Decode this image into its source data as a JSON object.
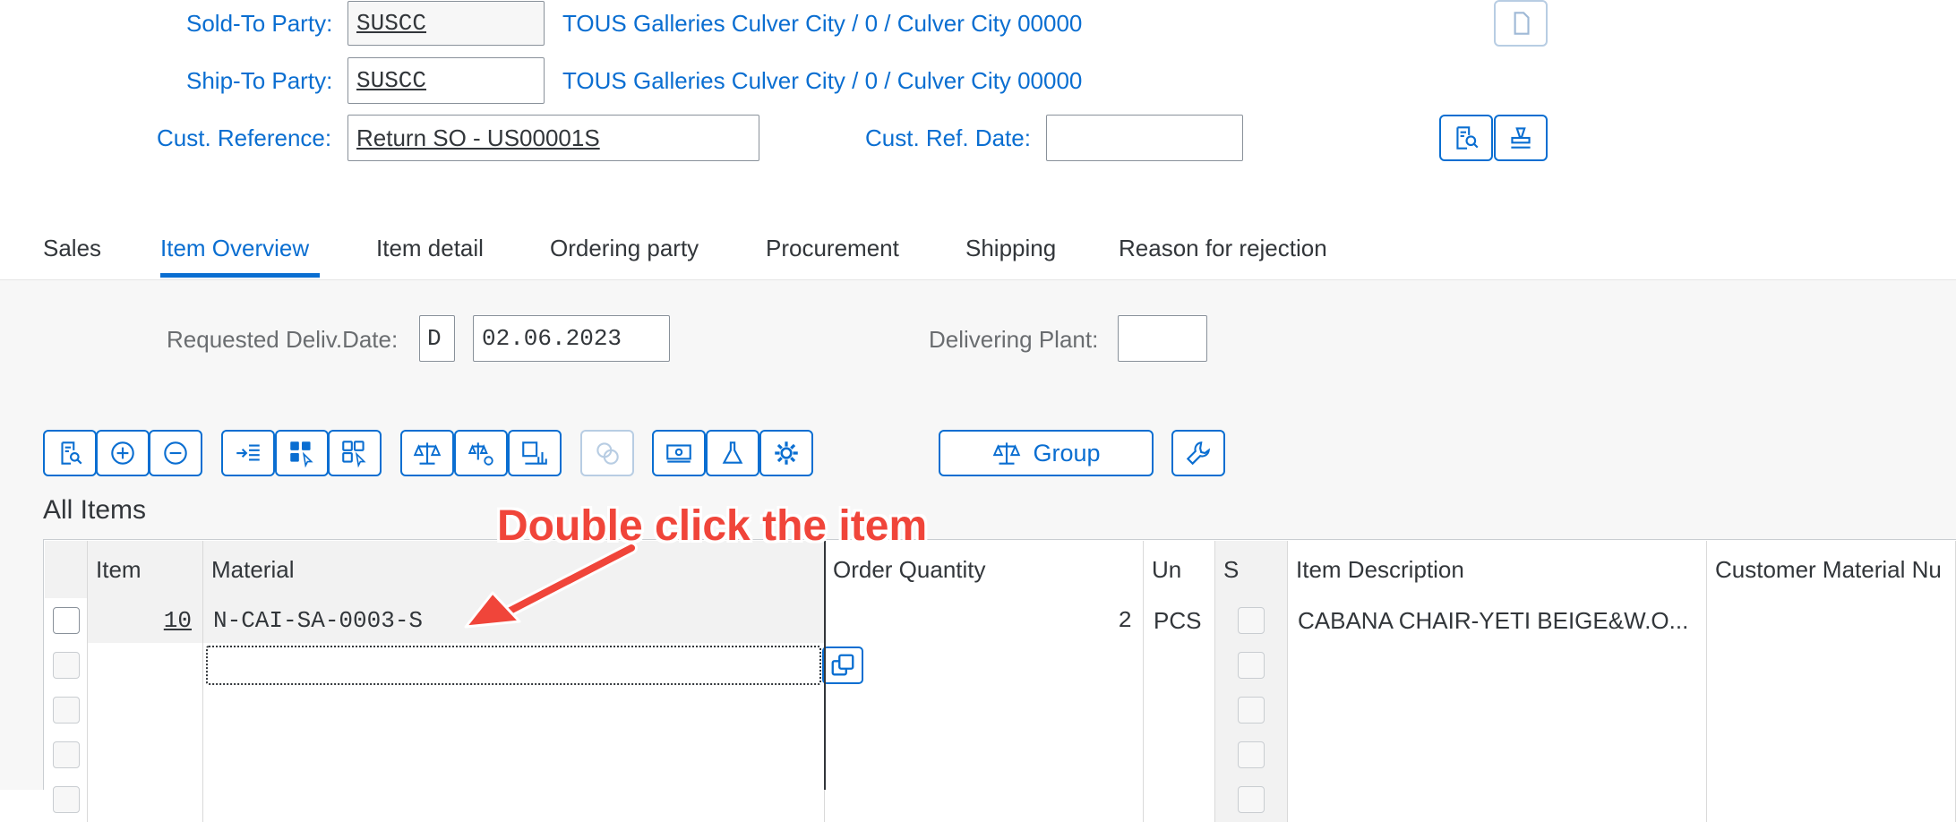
{
  "header": {
    "sold_to_label": "Sold-To Party:",
    "sold_to_value": "SUSCC",
    "sold_to_desc": "TOUS Galleries Culver City / 0 / Culver City 00000",
    "ship_to_label": "Ship-To Party:",
    "ship_to_value": "SUSCC",
    "ship_to_desc": "TOUS Galleries Culver City / 0 / Culver City 00000",
    "cust_ref_label": "Cust. Reference:",
    "cust_ref_value": "Return SO - US00001S",
    "cust_ref_date_label": "Cust. Ref. Date:",
    "cust_ref_date_value": ""
  },
  "tabs": [
    "Sales",
    "Item Overview",
    "Item detail",
    "Ordering party",
    "Procurement",
    "Shipping",
    "Reason for rejection"
  ],
  "overview": {
    "req_deliv_label": "Requested Deliv.Date:",
    "req_deliv_type": "D",
    "req_deliv_date": "02.06.2023",
    "plant_label": "Delivering Plant:",
    "plant_value": ""
  },
  "toolbar": {
    "group_label": "Group",
    "section_title": "All Items"
  },
  "annotation": {
    "text": "Double click the item",
    "color": "#f0453a"
  },
  "table": {
    "headers": [
      "Item",
      "Material",
      "Order Quantity",
      "Un",
      "S",
      "Item Description",
      "Customer Material Nu"
    ],
    "rows": [
      {
        "item": "10",
        "material": "N-CAI-SA-0003-S",
        "qty": "2",
        "unit": "PCS",
        "desc": "CABANA CHAIR-YETI BEIGE&W.O..."
      }
    ]
  },
  "colors": {
    "accent": "#0a6ed1",
    "background_gray": "#f7f7f7"
  }
}
